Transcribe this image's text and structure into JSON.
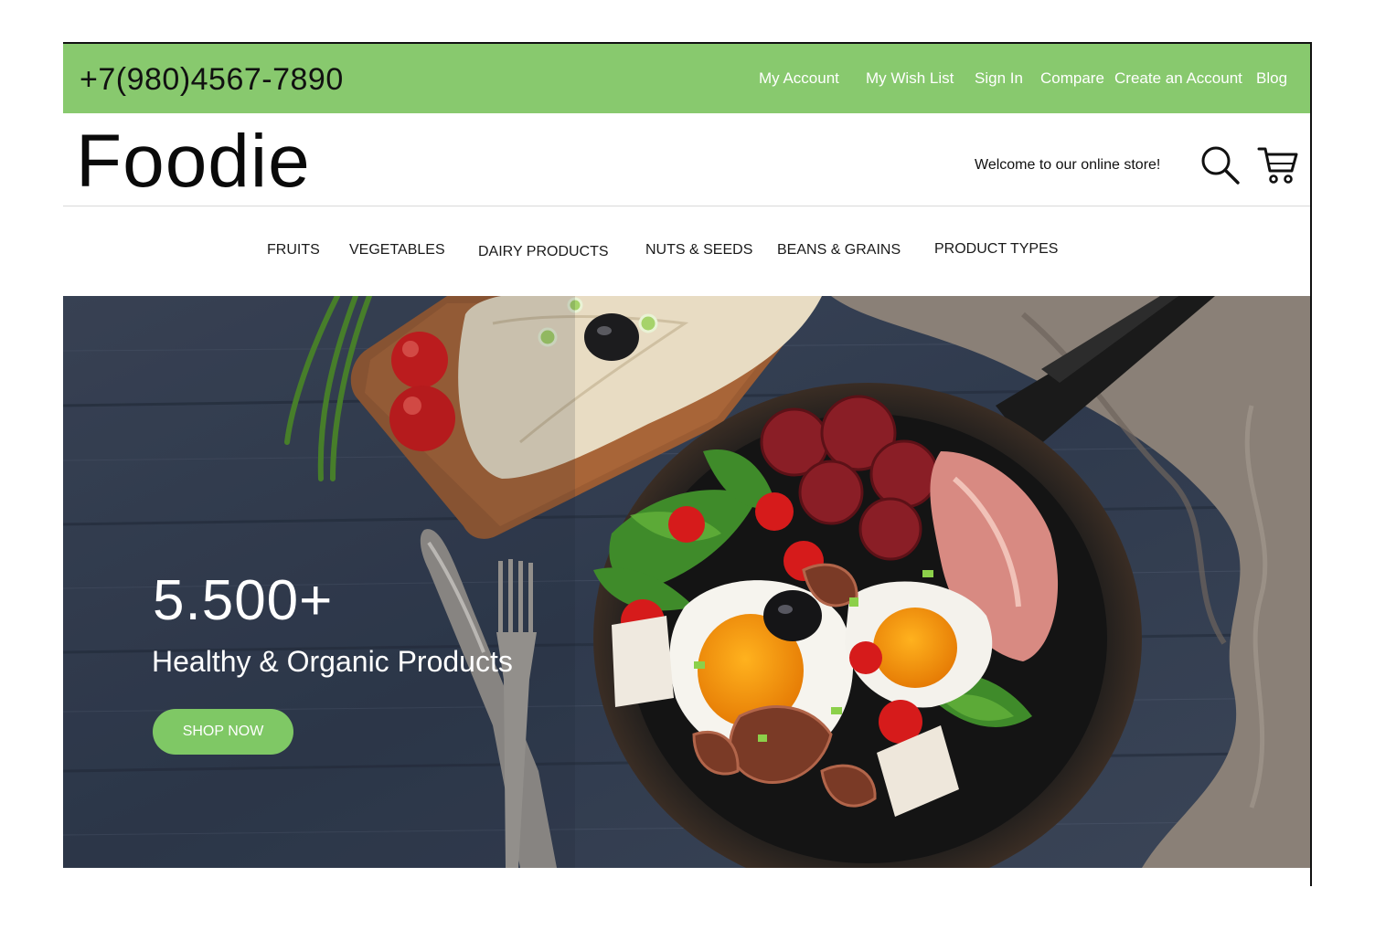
{
  "topbar": {
    "phone": "+7(980)4567-7890",
    "links": [
      "My Account",
      "My Wish List",
      "Sign In",
      "Compare",
      "Create an Account",
      "Blog"
    ]
  },
  "header": {
    "logo": "Foodie",
    "welcome": "Welcome to our online store!"
  },
  "nav": {
    "items": [
      "FRUITS",
      "VEGETABLES",
      "DAIRY PRODUCTS",
      "NUTS & SEEDS",
      "BEANS & GRAINS",
      "PRODUCT TYPES"
    ]
  },
  "hero": {
    "number": "5.500+",
    "subtitle": "Healthy & Organic Products",
    "button": "SHOP NOW"
  },
  "colors": {
    "accent_green": "#88c96e",
    "button_green": "#7fc865"
  },
  "icons": [
    "search-icon",
    "cart-icon"
  ]
}
